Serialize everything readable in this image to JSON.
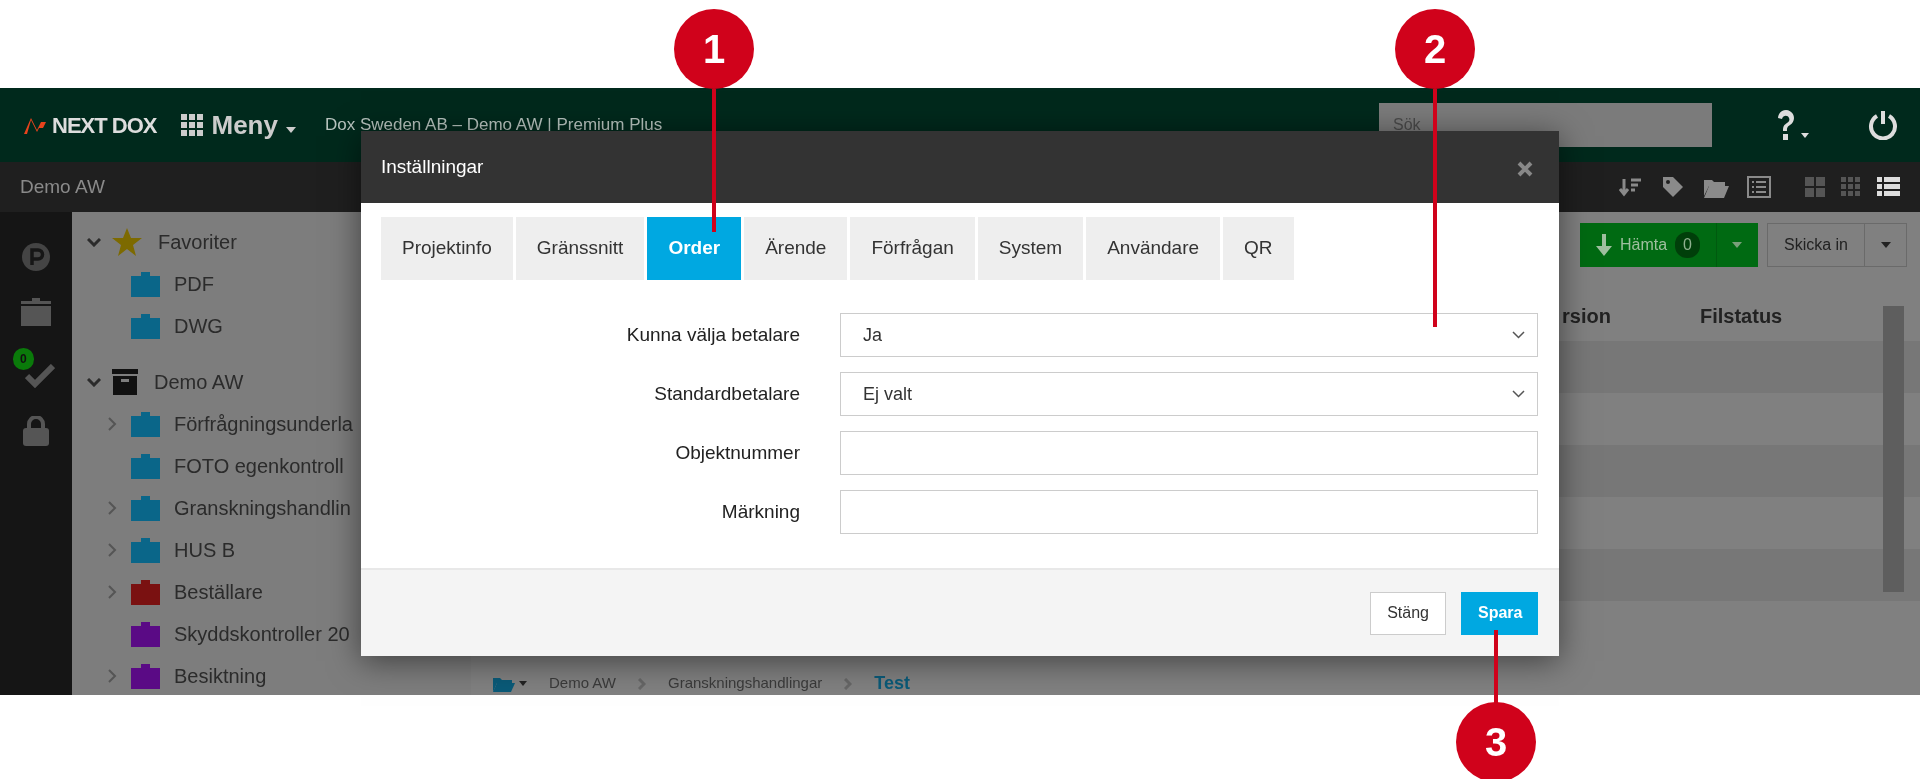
{
  "navbar": {
    "logo": "NEXT DOX",
    "menu": "Meny",
    "project": "Dox Sweden AB – Demo AW | Premium Plus",
    "search": {
      "placeholder": "Sök"
    }
  },
  "subbar": {
    "title": "Demo AW"
  },
  "rail": {
    "badge": "0"
  },
  "tree": [
    {
      "label": "Favoriter",
      "kind": "favorites",
      "expanded": true,
      "children": [
        {
          "label": "PDF",
          "kind": "folder",
          "color": "#0a6689"
        },
        {
          "label": "DWG",
          "kind": "folder",
          "color": "#0a6689"
        }
      ]
    },
    {
      "label": "Demo AW",
      "kind": "archive",
      "expanded": true,
      "children": [
        {
          "label": "Förfrågningsunderla",
          "kind": "folder",
          "color": "#0a6689",
          "expanded": false
        },
        {
          "label": "FOTO egenkontroll",
          "kind": "folder",
          "color": "#0a6689"
        },
        {
          "label": "Granskningshandlin",
          "kind": "folder",
          "color": "#0a6689",
          "expanded": false
        },
        {
          "label": "HUS B",
          "kind": "folder",
          "color": "#0a6689",
          "expanded": false
        },
        {
          "label": "Beställare",
          "kind": "folder",
          "color": "#7a1111",
          "expanded": false
        },
        {
          "label": "Skyddskontroller 20",
          "kind": "folder",
          "color": "#5a0a85"
        },
        {
          "label": "Besiktning",
          "kind": "folder",
          "color": "#5a0a85",
          "expanded": false
        }
      ]
    }
  ],
  "actions": {
    "download": {
      "label": "Hämta",
      "count": "0"
    },
    "submit": {
      "label": "Skicka in"
    }
  },
  "table": {
    "columns": [
      {
        "label": "rsion"
      },
      {
        "label": "Filstatus"
      }
    ]
  },
  "breadcrumb": [
    {
      "label": "Demo AW",
      "current": false
    },
    {
      "label": "Granskningshandlingar",
      "current": false
    },
    {
      "label": "Test",
      "current": true
    }
  ],
  "modal": {
    "title": "Inställningar",
    "tabs": [
      {
        "label": "Projektinfo",
        "selected": false
      },
      {
        "label": "Gränssnitt",
        "selected": false
      },
      {
        "label": "Order",
        "selected": true
      },
      {
        "label": "Ärende",
        "selected": false
      },
      {
        "label": "Förfrågan",
        "selected": false
      },
      {
        "label": "System",
        "selected": false
      },
      {
        "label": "Användare",
        "selected": false
      },
      {
        "label": "QR",
        "selected": false
      }
    ],
    "fields": [
      {
        "kind": "select",
        "label": "Kunna välja betalare",
        "value": "Ja"
      },
      {
        "kind": "select",
        "label": "Standardbetalare",
        "value": "Ej valt"
      },
      {
        "kind": "text",
        "label": "Objektnummer"
      },
      {
        "kind": "text",
        "label": "Märkning"
      }
    ],
    "buttons": [
      {
        "label": "Stäng",
        "kind": "secondary"
      },
      {
        "label": "Spara",
        "kind": "primary"
      }
    ]
  },
  "callouts": [
    {
      "number": "1"
    },
    {
      "number": "2"
    },
    {
      "number": "3"
    }
  ]
}
